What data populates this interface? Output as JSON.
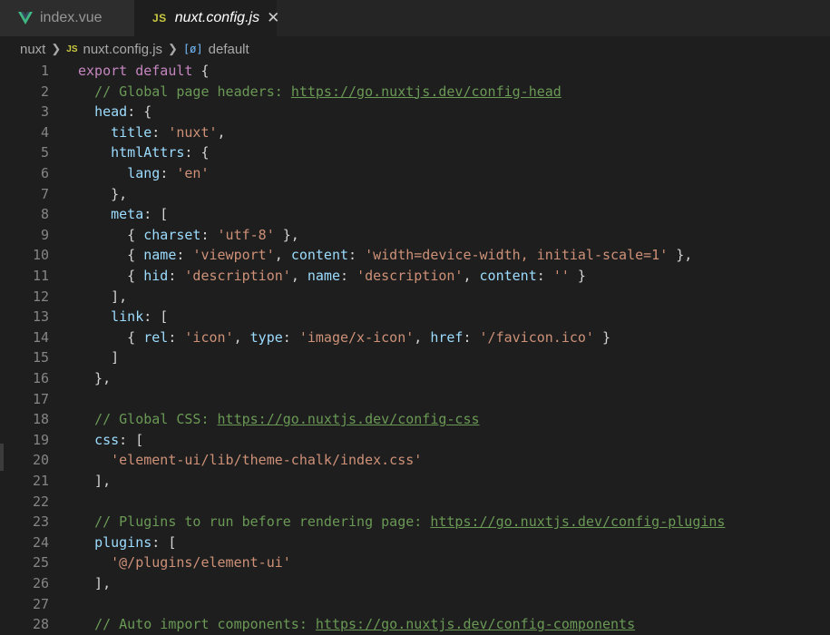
{
  "tabs": [
    {
      "label": "index.vue",
      "icon": "vue-icon",
      "active": false
    },
    {
      "label": "nuxt.config.js",
      "icon": "js-icon",
      "icon_text": "JS",
      "active": true,
      "close": "✕"
    }
  ],
  "breadcrumb": {
    "items": [
      "nuxt",
      "nuxt.config.js",
      "default"
    ],
    "js_icon_text": "JS",
    "symbol_icon_text": "[ø]"
  },
  "colors": {
    "keyword": "#c586c0",
    "property": "#9cdcfe",
    "string": "#ce9178",
    "comment": "#6a9955",
    "punct": "#d4d4d4",
    "function_kw": "#569cd6"
  },
  "code_lines": [
    {
      "n": "1",
      "tokens": [
        [
          "kw",
          "export"
        ],
        [
          "p",
          " "
        ],
        [
          "kw",
          "default"
        ],
        [
          "p",
          " {"
        ]
      ]
    },
    {
      "n": "2",
      "tokens": [
        [
          "p",
          "  "
        ],
        [
          "c",
          "// Global page headers: "
        ],
        [
          "cu",
          "https://go.nuxtjs.dev/config-head"
        ]
      ]
    },
    {
      "n": "3",
      "tokens": [
        [
          "p",
          "  "
        ],
        [
          "prop",
          "head"
        ],
        [
          "p",
          ": {"
        ]
      ]
    },
    {
      "n": "4",
      "tokens": [
        [
          "p",
          "    "
        ],
        [
          "prop",
          "title"
        ],
        [
          "p",
          ": "
        ],
        [
          "s",
          "'nuxt'"
        ],
        [
          "p",
          ","
        ]
      ]
    },
    {
      "n": "5",
      "tokens": [
        [
          "p",
          "    "
        ],
        [
          "prop",
          "htmlAttrs"
        ],
        [
          "p",
          ": {"
        ]
      ]
    },
    {
      "n": "6",
      "tokens": [
        [
          "p",
          "      "
        ],
        [
          "prop",
          "lang"
        ],
        [
          "p",
          ": "
        ],
        [
          "s",
          "'en'"
        ]
      ]
    },
    {
      "n": "7",
      "tokens": [
        [
          "p",
          "    },"
        ]
      ]
    },
    {
      "n": "8",
      "tokens": [
        [
          "p",
          "    "
        ],
        [
          "prop",
          "meta"
        ],
        [
          "p",
          ": ["
        ]
      ]
    },
    {
      "n": "9",
      "tokens": [
        [
          "p",
          "      { "
        ],
        [
          "prop",
          "charset"
        ],
        [
          "p",
          ": "
        ],
        [
          "s",
          "'utf-8'"
        ],
        [
          "p",
          " },"
        ]
      ]
    },
    {
      "n": "10",
      "tokens": [
        [
          "p",
          "      { "
        ],
        [
          "prop",
          "name"
        ],
        [
          "p",
          ": "
        ],
        [
          "s",
          "'viewport'"
        ],
        [
          "p",
          ", "
        ],
        [
          "prop",
          "content"
        ],
        [
          "p",
          ": "
        ],
        [
          "s",
          "'width=device-width, initial-scale=1'"
        ],
        [
          "p",
          " },"
        ]
      ]
    },
    {
      "n": "11",
      "tokens": [
        [
          "p",
          "      { "
        ],
        [
          "prop",
          "hid"
        ],
        [
          "p",
          ": "
        ],
        [
          "s",
          "'description'"
        ],
        [
          "p",
          ", "
        ],
        [
          "prop",
          "name"
        ],
        [
          "p",
          ": "
        ],
        [
          "s",
          "'description'"
        ],
        [
          "p",
          ", "
        ],
        [
          "prop",
          "content"
        ],
        [
          "p",
          ": "
        ],
        [
          "s",
          "''"
        ],
        [
          "p",
          " }"
        ]
      ]
    },
    {
      "n": "12",
      "tokens": [
        [
          "p",
          "    ],"
        ]
      ]
    },
    {
      "n": "13",
      "tokens": [
        [
          "p",
          "    "
        ],
        [
          "prop",
          "link"
        ],
        [
          "p",
          ": ["
        ]
      ]
    },
    {
      "n": "14",
      "tokens": [
        [
          "p",
          "      { "
        ],
        [
          "prop",
          "rel"
        ],
        [
          "p",
          ": "
        ],
        [
          "s",
          "'icon'"
        ],
        [
          "p",
          ", "
        ],
        [
          "prop",
          "type"
        ],
        [
          "p",
          ": "
        ],
        [
          "s",
          "'image/x-icon'"
        ],
        [
          "p",
          ", "
        ],
        [
          "prop",
          "href"
        ],
        [
          "p",
          ": "
        ],
        [
          "s",
          "'/favicon.ico'"
        ],
        [
          "p",
          " }"
        ]
      ]
    },
    {
      "n": "15",
      "tokens": [
        [
          "p",
          "    ]"
        ]
      ]
    },
    {
      "n": "16",
      "tokens": [
        [
          "p",
          "  },"
        ]
      ]
    },
    {
      "n": "17",
      "tokens": []
    },
    {
      "n": "18",
      "tokens": [
        [
          "p",
          "  "
        ],
        [
          "c",
          "// Global CSS: "
        ],
        [
          "cu",
          "https://go.nuxtjs.dev/config-css"
        ]
      ]
    },
    {
      "n": "19",
      "tokens": [
        [
          "p",
          "  "
        ],
        [
          "prop",
          "css"
        ],
        [
          "p",
          ": ["
        ]
      ]
    },
    {
      "n": "20",
      "tokens": [
        [
          "p",
          "    "
        ],
        [
          "s",
          "'element-ui/lib/theme-chalk/index.css'"
        ]
      ]
    },
    {
      "n": "21",
      "tokens": [
        [
          "p",
          "  ],"
        ]
      ]
    },
    {
      "n": "22",
      "tokens": []
    },
    {
      "n": "23",
      "tokens": [
        [
          "p",
          "  "
        ],
        [
          "c",
          "// Plugins to run before rendering page: "
        ],
        [
          "cu",
          "https://go.nuxtjs.dev/config-plugins"
        ]
      ]
    },
    {
      "n": "24",
      "tokens": [
        [
          "p",
          "  "
        ],
        [
          "prop",
          "plugins"
        ],
        [
          "p",
          ": ["
        ]
      ]
    },
    {
      "n": "25",
      "tokens": [
        [
          "p",
          "    "
        ],
        [
          "s",
          "'@/plugins/element-ui'"
        ]
      ]
    },
    {
      "n": "26",
      "tokens": [
        [
          "p",
          "  ],"
        ]
      ]
    },
    {
      "n": "27",
      "tokens": []
    },
    {
      "n": "28",
      "tokens": [
        [
          "p",
          "  "
        ],
        [
          "c",
          "// Auto import components: "
        ],
        [
          "cu",
          "https://go.nuxtjs.dev/config-components"
        ]
      ]
    }
  ]
}
